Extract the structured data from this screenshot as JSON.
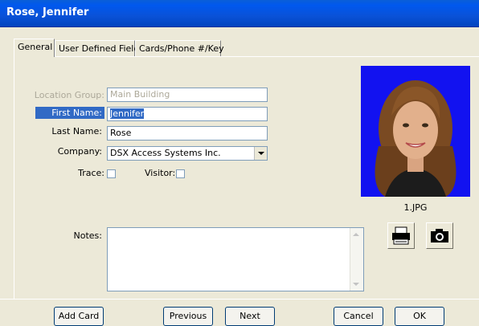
{
  "window": {
    "title": "Rose, Jennifer"
  },
  "tabs": [
    {
      "label": "General",
      "active": true
    },
    {
      "label": "User Defined Fields",
      "active": false
    },
    {
      "label": "Cards/Phone #/Key",
      "active": false
    }
  ],
  "form": {
    "location_group": {
      "label": "Location Group:",
      "value": "Main Building"
    },
    "first_name": {
      "label": "First Name:",
      "value": "Jennifer"
    },
    "last_name": {
      "label": "Last Name:",
      "value": "Rose"
    },
    "company": {
      "label": "Company:",
      "value": "DSX Access Systems Inc."
    },
    "trace": {
      "label": "Trace:",
      "checked": false
    },
    "visitor": {
      "label": "Visitor:",
      "checked": false
    },
    "notes": {
      "label": "Notes:",
      "value": ""
    }
  },
  "photo": {
    "caption": "1.JPG"
  },
  "buttons": {
    "add_card": "Add Card",
    "previous": "Previous",
    "next": "Next",
    "cancel": "Cancel",
    "ok": "OK"
  },
  "icons": {
    "print": "printer-icon",
    "camera": "camera-icon"
  },
  "colors": {
    "title_bar": "#0a52d8",
    "photo_bg": "#1010ff",
    "selection": "#316ac5"
  }
}
